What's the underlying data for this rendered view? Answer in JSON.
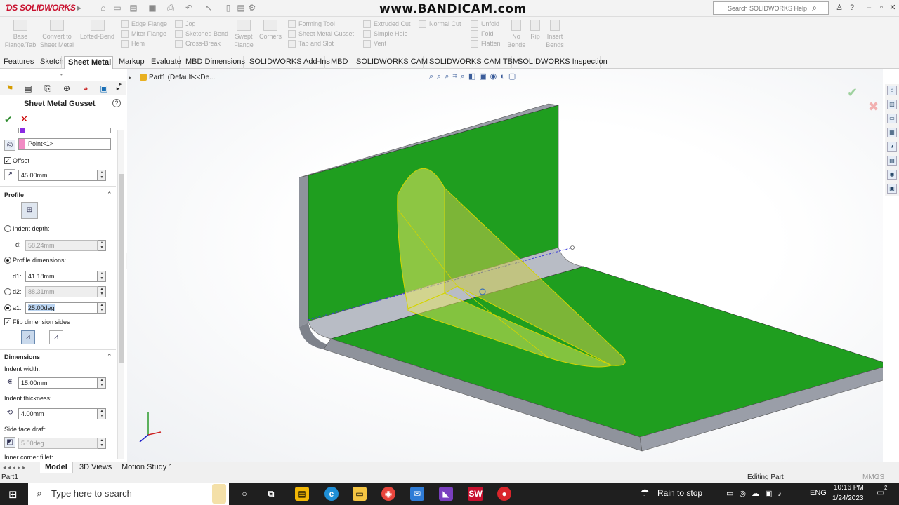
{
  "app": {
    "logo_text": "SOLIDWORKS",
    "watermark": "www.BANDICAM.com",
    "help_search_placeholder": "Search SOLIDWORKS Help"
  },
  "ribbon": {
    "buttons_big": [
      {
        "label": "Base Flange/Tab"
      },
      {
        "label": "Convert to Sheet Metal"
      },
      {
        "label": "Lofted-Bend"
      },
      {
        "label": "Swept Flange"
      },
      {
        "label": "Corners"
      },
      {
        "label": "No Bends"
      },
      {
        "label": "Rip"
      },
      {
        "label": "Insert Bends"
      }
    ],
    "rows": {
      "col1": [
        "Edge Flange",
        "Miter Flange",
        "Hem"
      ],
      "col2": [
        "Jog",
        "Sketched Bend",
        "Cross-Break"
      ],
      "col3": [
        "Forming Tool",
        "Sheet Metal Gusset",
        "Tab and Slot"
      ],
      "col4": [
        "Extruded Cut",
        "Simple Hole",
        "Vent"
      ],
      "col5": [
        "Normal Cut"
      ],
      "col6": [
        "Unfold",
        "Fold",
        "Flatten"
      ]
    }
  },
  "tabs": [
    {
      "label": "Features"
    },
    {
      "label": "Sketch"
    },
    {
      "label": "Sheet Metal"
    },
    {
      "label": "Markup"
    },
    {
      "label": "Evaluate"
    },
    {
      "label": "MBD Dimensions"
    },
    {
      "label": "SOLIDWORKS Add-Ins"
    },
    {
      "label": "MBD"
    },
    {
      "label": "SOLIDWORKS CAM"
    },
    {
      "label": "SOLIDWORKS CAM TBM"
    },
    {
      "label": "SOLIDWORKS Inspection"
    }
  ],
  "property_manager": {
    "title": "Sheet Metal Gusset",
    "ref_point": "Point<1>",
    "offset_label": "Offset",
    "offset_value": "45.00mm",
    "profile": {
      "header": "Profile",
      "indent_depth_label": "Indent depth:",
      "d_label": "d:",
      "d_value": "58.24mm",
      "profile_dimensions_label": "Profile dimensions:",
      "d1_label": "d1:",
      "d1_value": "41.18mm",
      "d2_label": "d2:",
      "d2_value": "88.31mm",
      "a1_label": "a1:",
      "a1_value": "25.00deg",
      "flip_label": "Flip dimension sides"
    },
    "dimensions": {
      "header": "Dimensions",
      "indent_width_label": "Indent width:",
      "indent_width_value": "15.00mm",
      "indent_thickness_label": "Indent thickness:",
      "indent_thickness_value": "4.00mm",
      "side_face_draft_label": "Side face draft:",
      "side_face_draft_value": "5.00deg",
      "inner_corner_fillet_label": "Inner corner fillet:"
    }
  },
  "viewport": {
    "breadcrumb": "Part1  (Default<<De..."
  },
  "bottom_tabs": [
    {
      "label": "Model"
    },
    {
      "label": "3D Views"
    },
    {
      "label": "Motion Study 1"
    }
  ],
  "status": {
    "left": "Part1",
    "mode": "Editing Part",
    "units": "MMGS"
  },
  "taskbar": {
    "search_placeholder": "Type here to search",
    "weather": "Rain to stop",
    "language": "ENG",
    "time": "10:16 PM",
    "date": "1/24/2023",
    "notifications": "2"
  },
  "colors": {
    "sheet_green": "#1f9e1f",
    "edge_gray": "#8f939c",
    "gusset_yellow": "#e8e860"
  }
}
